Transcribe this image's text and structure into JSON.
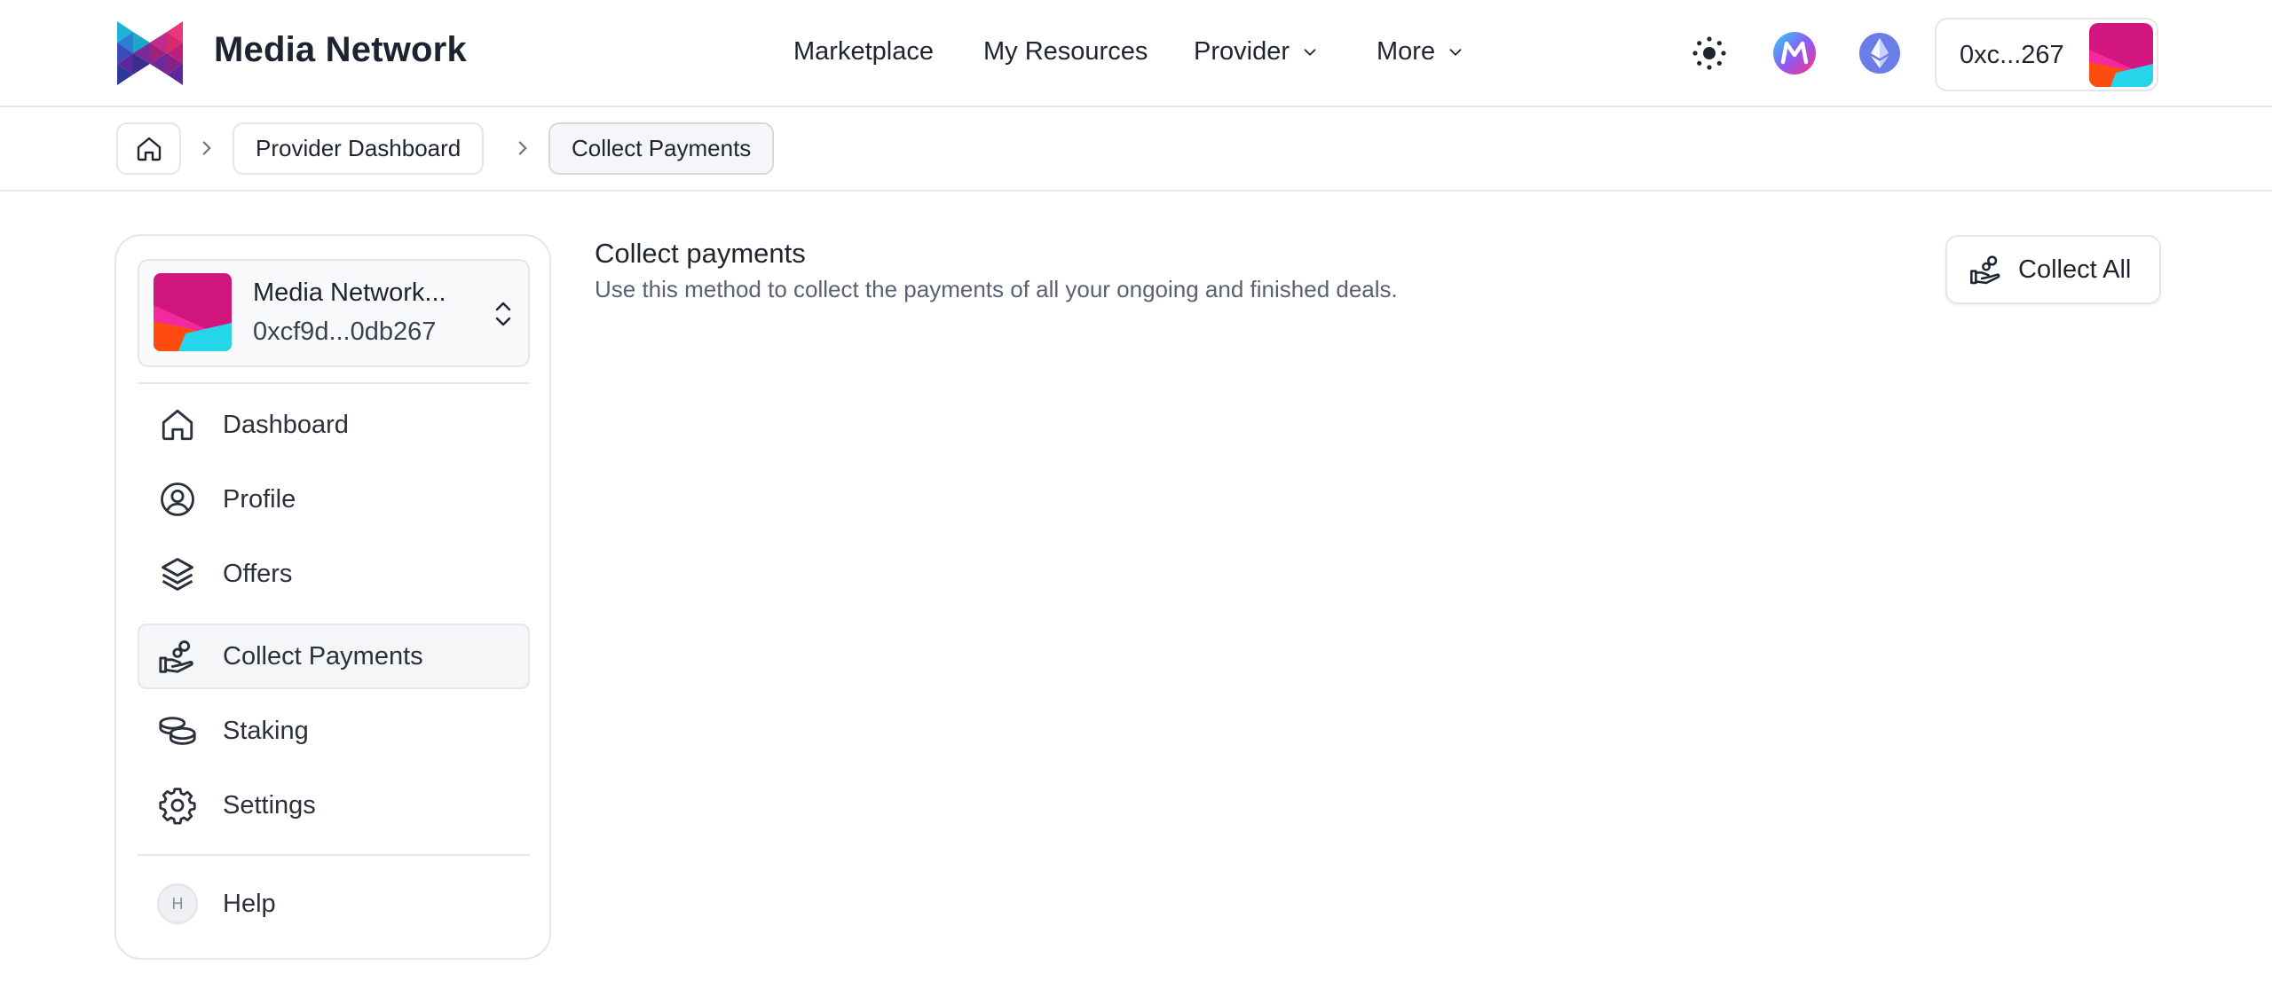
{
  "header": {
    "brand": "Media Network",
    "nav": [
      {
        "label": "Marketplace"
      },
      {
        "label": "My Resources"
      },
      {
        "label": "Provider"
      },
      {
        "label": "More"
      }
    ],
    "wallet_address": "0xc...267"
  },
  "breadcrumb": {
    "items": [
      {
        "label": "Provider Dashboard"
      },
      {
        "label": "Collect Payments"
      }
    ]
  },
  "sidebar": {
    "account_name": "Media Network...",
    "account_address": "0xcf9d...0db267",
    "items": [
      {
        "label": "Dashboard",
        "icon": "home-icon"
      },
      {
        "label": "Profile",
        "icon": "user-circle-icon"
      },
      {
        "label": "Offers",
        "icon": "layers-icon"
      },
      {
        "label": "Collect Payments",
        "icon": "hand-coins-icon",
        "active": true
      },
      {
        "label": "Staking",
        "icon": "coins-icon"
      },
      {
        "label": "Settings",
        "icon": "gear-icon"
      }
    ],
    "help_badge": "H",
    "help_label": "Help"
  },
  "main": {
    "title": "Collect payments",
    "description": "Use this method to collect the payments of all your ongoing and finished deals.",
    "collect_all_label": "Collect All"
  },
  "colors": {
    "avatar_magenta": "#d1177f",
    "avatar_pink": "#f5299f",
    "avatar_orange": "#ff4b10",
    "avatar_cyan": "#25d6ea",
    "border": "#e4e6ea"
  }
}
